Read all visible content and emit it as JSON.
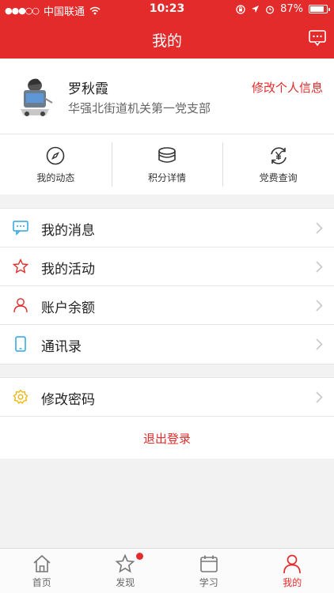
{
  "status_bar": {
    "carrier": "中国联通",
    "time": "10:23",
    "battery": "87%",
    "battery_level": 0.87
  },
  "header": {
    "title": "我的",
    "message_icon": "chat-bubble-icon"
  },
  "profile": {
    "name": "罗秋霞",
    "organization": "华强北街道机关第一党支部",
    "edit_label": "修改个人信息"
  },
  "quick_actions": [
    {
      "label": "我的动态",
      "icon": "compass-icon"
    },
    {
      "label": "积分详情",
      "icon": "coins-icon"
    },
    {
      "label": "党费查询",
      "icon": "yen-refresh-icon"
    }
  ],
  "menu_group_1": [
    {
      "label": "我的消息",
      "icon": "message-icon",
      "color": "#2aa6e0"
    },
    {
      "label": "我的活动",
      "icon": "star-icon",
      "color": "#e32b2b"
    },
    {
      "label": "账户余额",
      "icon": "user-icon",
      "color": "#e32b2b"
    },
    {
      "label": "通讯录",
      "icon": "phone-icon",
      "color": "#2aa6e0"
    }
  ],
  "menu_group_2": [
    {
      "label": "修改密码",
      "icon": "gear-icon",
      "color": "#f0b400"
    }
  ],
  "logout_label": "退出登录",
  "tabs": [
    {
      "label": "首页",
      "icon": "home-icon",
      "active": false
    },
    {
      "label": "发现",
      "icon": "star-outline-icon",
      "active": false,
      "badge": true
    },
    {
      "label": "学习",
      "icon": "calendar-icon",
      "active": false
    },
    {
      "label": "我的",
      "icon": "person-icon",
      "active": true
    }
  ],
  "colors": {
    "brand": "#e32b2b",
    "background": "#f2f2f2"
  }
}
